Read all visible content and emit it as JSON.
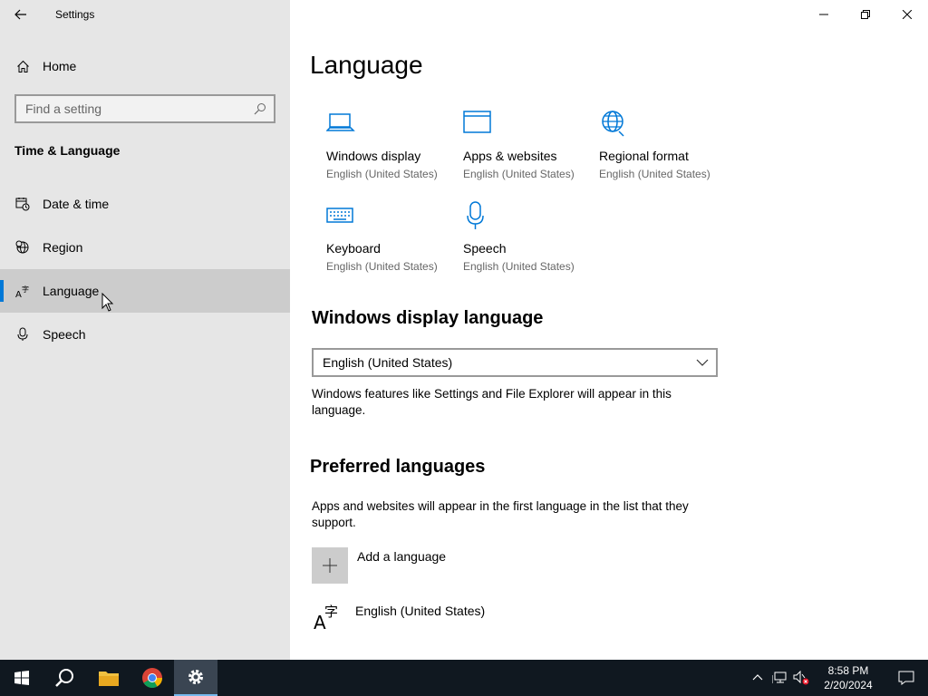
{
  "window": {
    "title": "Settings"
  },
  "sidebar": {
    "home_label": "Home",
    "search_placeholder": "Find a setting",
    "section_title": "Time & Language",
    "items": [
      {
        "label": "Date & time",
        "icon": "calendar-clock-icon"
      },
      {
        "label": "Region",
        "icon": "globe-icon"
      },
      {
        "label": "Language",
        "icon": "language-icon",
        "active": true
      },
      {
        "label": "Speech",
        "icon": "microphone-icon"
      }
    ]
  },
  "main": {
    "title": "Language",
    "tiles": [
      {
        "name": "Windows display",
        "sub": "English (United States)",
        "icon": "laptop-icon"
      },
      {
        "name": "Apps & websites",
        "sub": "English (United States)",
        "icon": "browser-window-icon"
      },
      {
        "name": "Regional format",
        "sub": "English (United States)",
        "icon": "globe-icon"
      },
      {
        "name": "Keyboard",
        "sub": "English (United States)",
        "icon": "keyboard-icon"
      },
      {
        "name": "Speech",
        "sub": "English (United States)",
        "icon": "microphone-icon"
      }
    ],
    "display_language": {
      "heading": "Windows display language",
      "selected": "English (United States)",
      "description": "Windows features like Settings and File Explorer will appear in this language."
    },
    "preferred": {
      "heading": "Preferred languages",
      "description": "Apps and websites will appear in the first language in the list that they support.",
      "add_label": "Add a language",
      "languages": [
        "English (United States)"
      ]
    }
  },
  "taskbar": {
    "time": "8:58 PM",
    "date": "2/20/2024"
  },
  "colors": {
    "accent": "#0078d7",
    "sidebar_bg": "#e6e6e6",
    "taskbar_bg": "#101820"
  }
}
